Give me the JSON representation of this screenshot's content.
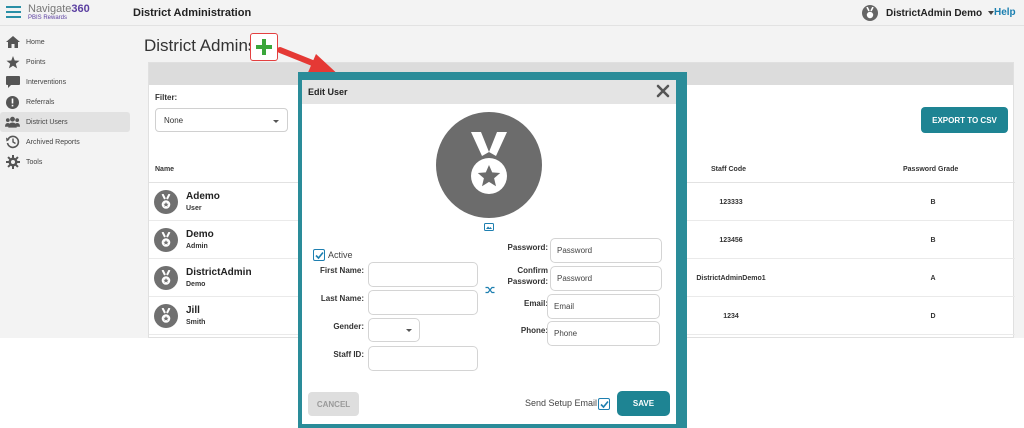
{
  "brand": {
    "name_prefix": "Navigate",
    "name_suffix": "360",
    "subtitle": "PBIS Rewards"
  },
  "topbar": {
    "heading": "District Administration",
    "user_name": "DistrictAdmin Demo",
    "help": "Help"
  },
  "sidebar": {
    "items": [
      {
        "label": "Home",
        "icon": "home-icon"
      },
      {
        "label": "Points",
        "icon": "star-icon"
      },
      {
        "label": "Interventions",
        "icon": "chat-bubble-icon"
      },
      {
        "label": "Referrals",
        "icon": "alert-icon"
      },
      {
        "label": "District Users",
        "icon": "users-icon",
        "active": true
      },
      {
        "label": "Archived Reports",
        "icon": "history-icon"
      },
      {
        "label": "Tools",
        "icon": "gear-icon"
      }
    ]
  },
  "content": {
    "title": "District Admins",
    "filter_label": "Filter:",
    "filter_value": "None",
    "export_label": "EXPORT TO CSV",
    "columns": {
      "name": "Name",
      "staff_code": "Staff Code",
      "password_grade": "Password Grade"
    },
    "rows": [
      {
        "first": "Ademo",
        "second": "User",
        "staff_code": "123333",
        "grade": "B"
      },
      {
        "first": "Demo",
        "second": "Admin",
        "staff_code": "123456",
        "grade": "B"
      },
      {
        "first": "DistrictAdmin",
        "second": "Demo",
        "staff_code": "DistrictAdminDemo1",
        "grade": "A"
      },
      {
        "first": "Jill",
        "second": "Smith",
        "staff_code": "1234",
        "grade": "D"
      }
    ]
  },
  "modal": {
    "title": "Edit User",
    "active_label": "Active",
    "active_checked": true,
    "first_name_label": "First Name:",
    "last_name_label": "Last Name:",
    "gender_label": "Gender:",
    "staff_id_label": "Staff ID:",
    "password_label": "Password:",
    "password_placeholder": "Password",
    "confirm_label_1": "Confirm",
    "confirm_label_2": "Password:",
    "confirm_placeholder": "Password",
    "email_label": "Email:",
    "email_placeholder": "Email",
    "phone_label": "Phone:",
    "phone_placeholder": "Phone",
    "cancel_label": "CANCEL",
    "send_setup_label": "Send Setup Email",
    "send_setup_checked": true,
    "save_label": "SAVE"
  },
  "colors": {
    "accent": "#1e8493",
    "modal_frame": "#2a8c99",
    "add_green": "#3aa63a",
    "arrow_red": "#e53935",
    "brand_purple": "#5a3ea0"
  }
}
